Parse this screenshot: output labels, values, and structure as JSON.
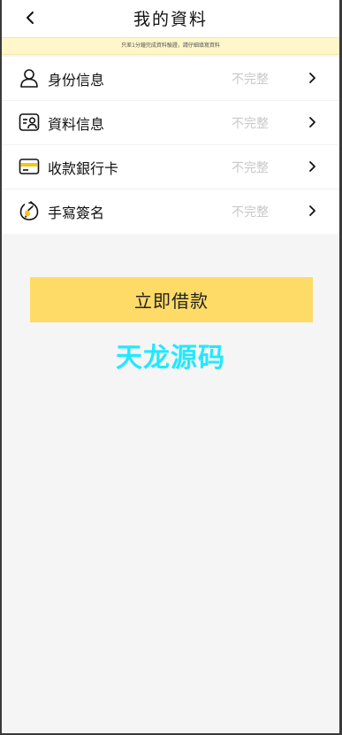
{
  "header": {
    "title": "我的資料",
    "back_icon": "chevron-left-icon"
  },
  "notice": {
    "text": "只差1分鐘完成資料驗證，請仔細填寫資料"
  },
  "items": [
    {
      "label": "身份信息",
      "status": "不完整",
      "icon": "person-icon"
    },
    {
      "label": "資料信息",
      "status": "不完整",
      "icon": "profile-card-icon"
    },
    {
      "label": "收款銀行卡",
      "status": "不完整",
      "icon": "bank-card-icon"
    },
    {
      "label": "手寫簽名",
      "status": "不完整",
      "icon": "signature-icon"
    }
  ],
  "action": {
    "borrow_label": "立即借款"
  },
  "watermark": {
    "text": "天龙源码"
  },
  "colors": {
    "accent": "#fedb66",
    "notice_bg": "#fff6c9",
    "watermark": "#22e8ff",
    "status_text": "#c8c8c8",
    "icon_yellow": "#f5c518"
  }
}
